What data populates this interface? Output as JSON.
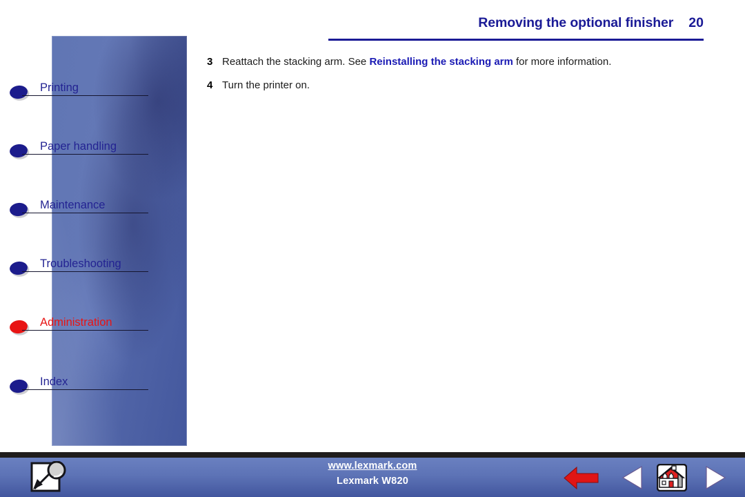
{
  "header": {
    "title": "Removing the optional finisher",
    "page_number": "20",
    "accent_color": "#1a1a96"
  },
  "sidebar": {
    "items": [
      {
        "label": "Printing",
        "icon": "bullet-icon",
        "active": false,
        "bullet_color": "#1c1c8c"
      },
      {
        "label": "Paper handling",
        "icon": "bullet-icon",
        "active": false,
        "bullet_color": "#1c1c8c"
      },
      {
        "label": "Maintenance",
        "icon": "bullet-icon",
        "active": false,
        "bullet_color": "#1c1c8c"
      },
      {
        "label": "Troubleshooting",
        "icon": "bullet-icon",
        "active": false,
        "bullet_color": "#1c1c8c"
      },
      {
        "label": "Administration",
        "icon": "bullet-icon",
        "active": true,
        "bullet_color": "#e81414"
      },
      {
        "label": "Index",
        "icon": "bullet-icon",
        "active": false,
        "bullet_color": "#1c1c8c"
      }
    ]
  },
  "content": {
    "steps": [
      {
        "number": "3",
        "text_before": "Reattach the stacking arm. See ",
        "link": "Reinstalling the stacking arm",
        "text_after": " for more information."
      },
      {
        "number": "4",
        "text_before": "Turn the printer on.",
        "link": "",
        "text_after": ""
      }
    ],
    "link_color": "#1a1ab4"
  },
  "footer": {
    "search_icon": "search-page-icon",
    "url": "www.lexmark.com",
    "product": "Lexmark W820",
    "buttons": [
      {
        "name": "back-arrow-icon",
        "label": "Back",
        "color": "#e01515"
      },
      {
        "name": "previous-triangle-icon",
        "label": "Previous",
        "color": "#ffffff"
      },
      {
        "name": "home-house-icon",
        "label": "Home",
        "color": "#e01515"
      },
      {
        "name": "next-triangle-icon",
        "label": "Next",
        "color": "#ffffff"
      }
    ],
    "background_top": "#6a80c0",
    "background_bottom": "#42569e"
  }
}
